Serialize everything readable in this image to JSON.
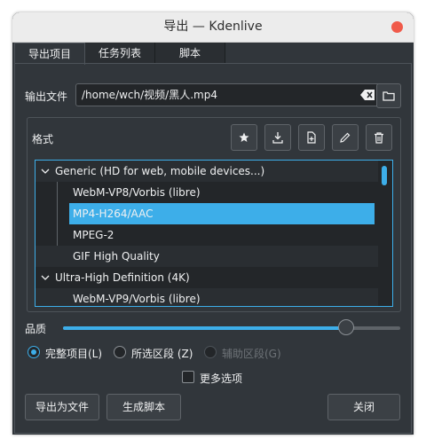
{
  "window": {
    "title": "导出 — Kdenlive"
  },
  "tabs": [
    {
      "label": "导出项目"
    },
    {
      "label": "任务列表"
    },
    {
      "label": "脚本"
    }
  ],
  "output": {
    "label": "输出文件",
    "value": "/home/wch/视频/黑人.mp4"
  },
  "format": {
    "label": "格式",
    "toolbar_icons": [
      "star-icon",
      "download-icon",
      "new-file-icon",
      "edit-pencil-icon",
      "trash-icon"
    ],
    "tree": [
      {
        "label": "Generic (HD for web, mobile devices...)",
        "type": "group",
        "expanded": true
      },
      {
        "label": "WebM-VP8/Vorbis (libre)",
        "type": "item"
      },
      {
        "label": "MP4-H264/AAC",
        "type": "item",
        "selected": true
      },
      {
        "label": "MPEG-2",
        "type": "item"
      },
      {
        "label": "GIF High Quality",
        "type": "item"
      },
      {
        "label": "Ultra-High Definition (4K)",
        "type": "group",
        "expanded": true
      },
      {
        "label": "WebM-VP9/Vorbis (libre)",
        "type": "item"
      }
    ]
  },
  "quality": {
    "label": "品质",
    "value_fraction": 0.84
  },
  "range": {
    "options": [
      {
        "label": "完整项目(L)",
        "checked": true,
        "disabled": false
      },
      {
        "label": "所选区段 (Z)",
        "checked": false,
        "disabled": false
      },
      {
        "label": "辅助区段(G)",
        "checked": false,
        "disabled": true
      }
    ]
  },
  "more_options": {
    "label": "更多选项",
    "checked": false
  },
  "buttons": {
    "export": "导出为文件",
    "script": "生成脚本",
    "close": "关闭"
  },
  "colors": {
    "accent": "#3daee9",
    "background": "#31363b",
    "close": "#f05a4a"
  }
}
